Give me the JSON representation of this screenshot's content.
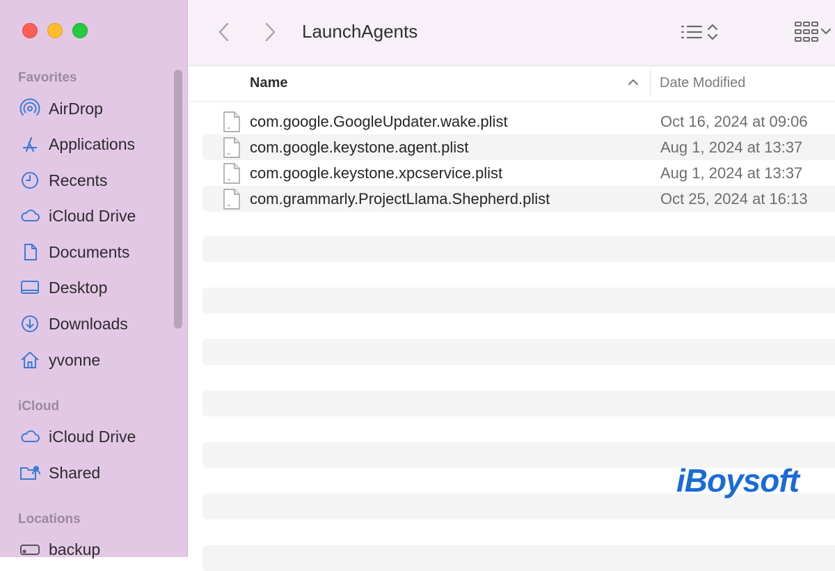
{
  "window": {
    "title": "LaunchAgents"
  },
  "sidebar": {
    "sections": [
      {
        "title": "Favorites",
        "items": [
          {
            "label": "AirDrop",
            "icon": "airdrop-icon"
          },
          {
            "label": "Applications",
            "icon": "applications-icon"
          },
          {
            "label": "Recents",
            "icon": "clock-icon"
          },
          {
            "label": "iCloud Drive",
            "icon": "cloud-icon"
          },
          {
            "label": "Documents",
            "icon": "document-icon"
          },
          {
            "label": "Desktop",
            "icon": "desktop-icon"
          },
          {
            "label": "Downloads",
            "icon": "download-icon"
          },
          {
            "label": "yvonne",
            "icon": "home-icon"
          }
        ]
      },
      {
        "title": "iCloud",
        "items": [
          {
            "label": "iCloud Drive",
            "icon": "cloud-icon"
          },
          {
            "label": "Shared",
            "icon": "shared-folder-icon"
          }
        ]
      },
      {
        "title": "Locations",
        "items": [
          {
            "label": "backup",
            "icon": "drive-icon"
          }
        ]
      }
    ]
  },
  "list": {
    "columns": {
      "name": "Name",
      "date": "Date Modified"
    },
    "sort": "name-ascending",
    "rows": [
      {
        "name": "com.google.GoogleUpdater.wake.plist",
        "date": "Oct 16, 2024 at 09:06"
      },
      {
        "name": "com.google.keystone.agent.plist",
        "date": "Aug 1, 2024 at 13:37"
      },
      {
        "name": "com.google.keystone.xpcservice.plist",
        "date": "Aug 1, 2024 at 13:37"
      },
      {
        "name": "com.grammarly.ProjectLlama.Shepherd.plist",
        "date": "Oct 25, 2024 at 16:13"
      }
    ]
  },
  "watermark": "iBoysoft",
  "colors": {
    "sidebar_bg": "#e3c8e6",
    "accent_blue": "#3a7bd5",
    "brand_blue": "#1a6bd8"
  }
}
